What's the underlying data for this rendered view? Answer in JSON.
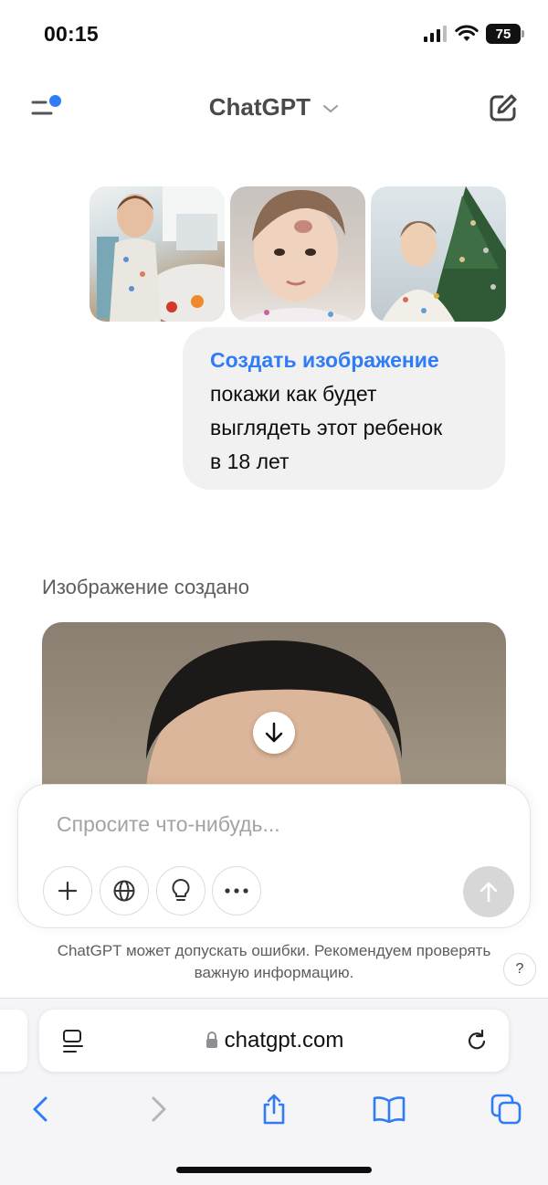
{
  "status_bar": {
    "time": "00:15",
    "battery": "75"
  },
  "header": {
    "title": "ChatGPT"
  },
  "conversation": {
    "user_message": {
      "tool_label": "Создать изображение",
      "text": "покажи как будет\nвыглядеть этот ребенок\nв 18 лет"
    },
    "assistant": {
      "status": "Изображение создано"
    }
  },
  "composer": {
    "placeholder": "Спросите что-нибудь..."
  },
  "disclaimer": {
    "line1": "ChatGPT может допускать ошибки. Рекомендуем проверять",
    "line2": "важную информацию.",
    "help": "?"
  },
  "browser": {
    "host": "chatgpt.com"
  },
  "colors": {
    "accent": "#2f7cf6",
    "bubble": "#f1f1f1",
    "send_disabled": "#d7d7d7"
  }
}
